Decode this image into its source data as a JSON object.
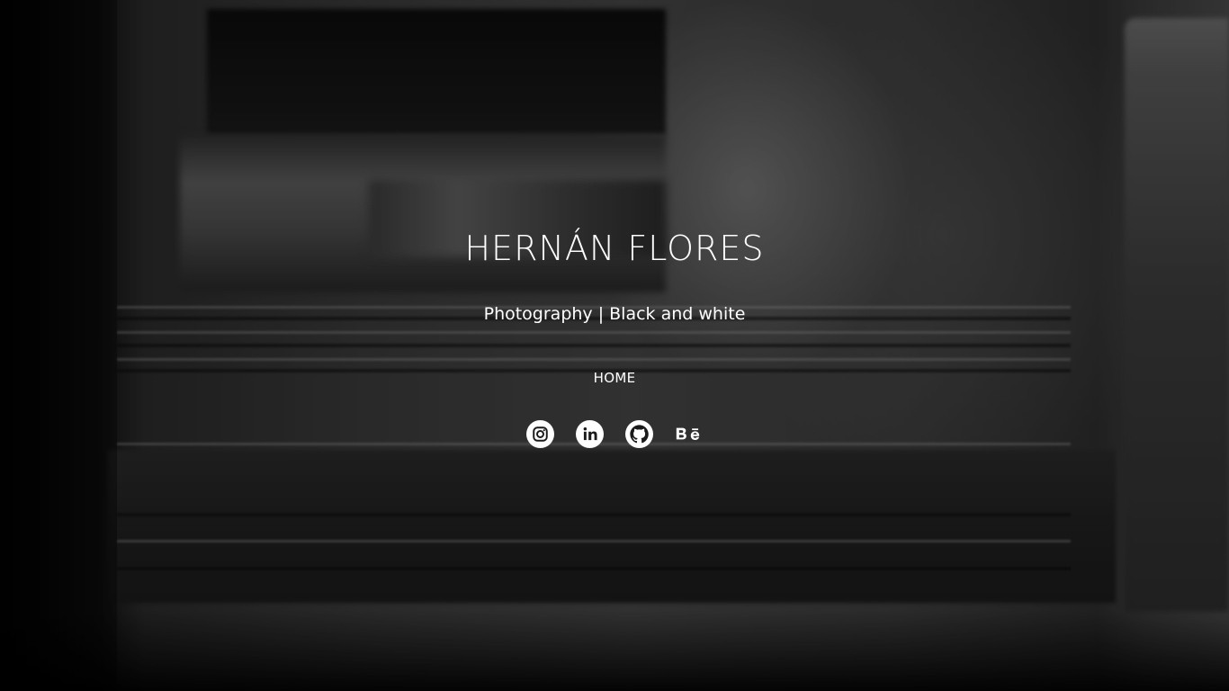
{
  "site": {
    "title": "HERNÁN FLORES",
    "subtitle": "Photography | Black and white"
  },
  "nav": {
    "items": [
      {
        "label": "HOME"
      }
    ]
  },
  "social": {
    "links": [
      {
        "name": "instagram",
        "icon": "instagram-icon"
      },
      {
        "name": "linkedin",
        "icon": "linkedin-icon"
      },
      {
        "name": "github",
        "icon": "github-icon"
      },
      {
        "name": "behance",
        "icon": "behance-icon"
      }
    ]
  },
  "colors": {
    "text": "#ffffff",
    "background": "#151515"
  }
}
